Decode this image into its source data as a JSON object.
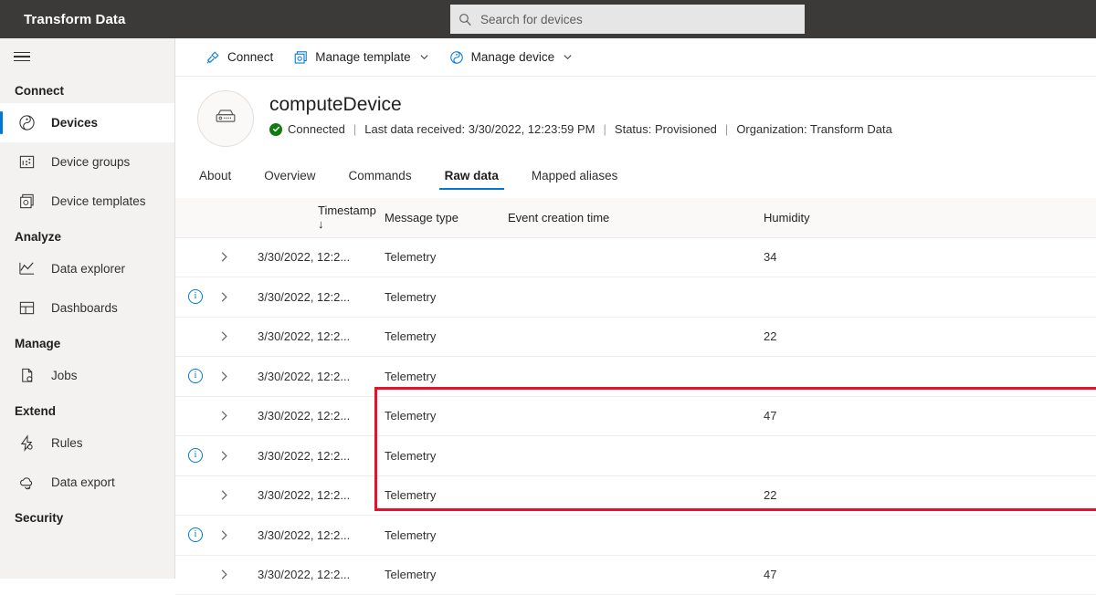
{
  "topbar": {
    "brand": "Transform Data",
    "search": {
      "placeholder": "Search for devices",
      "value": "",
      "icon": "search-icon"
    }
  },
  "sidebar": {
    "menu_icon": "hamburger-icon",
    "groups": [
      {
        "title": "Connect",
        "items": [
          {
            "label": "Devices",
            "icon": "devices-icon",
            "active": true
          },
          {
            "label": "Device groups",
            "icon": "device-groups-icon",
            "active": false
          },
          {
            "label": "Device templates",
            "icon": "device-templates-icon",
            "active": false
          }
        ]
      },
      {
        "title": "Analyze",
        "items": [
          {
            "label": "Data explorer",
            "icon": "data-explorer-icon",
            "active": false
          },
          {
            "label": "Dashboards",
            "icon": "dashboards-icon",
            "active": false
          }
        ]
      },
      {
        "title": "Manage",
        "items": [
          {
            "label": "Jobs",
            "icon": "jobs-icon",
            "active": false
          }
        ]
      },
      {
        "title": "Extend",
        "items": [
          {
            "label": "Rules",
            "icon": "rules-icon",
            "active": false
          },
          {
            "label": "Data export",
            "icon": "data-export-icon",
            "active": false
          }
        ]
      },
      {
        "title": "Security",
        "items": []
      }
    ]
  },
  "commandbar": {
    "items": [
      {
        "label": "Connect",
        "icon": "plug-icon",
        "has_chevron": false
      },
      {
        "label": "Manage template",
        "icon": "template-icon",
        "has_chevron": true
      },
      {
        "label": "Manage device",
        "icon": "device-icon",
        "has_chevron": true
      }
    ]
  },
  "device": {
    "avatar_icon": "server-device-icon",
    "name": "computeDevice",
    "connection_status": "Connected",
    "connection_icon": "check-circle-icon",
    "last_data_label": "Last data received: 3/30/2022, 12:23:59 PM",
    "status_label": "Status: Provisioned",
    "organization_label": "Organization: Transform Data",
    "separator": "|"
  },
  "tabs": [
    {
      "label": "About",
      "selected": false
    },
    {
      "label": "Overview",
      "selected": false
    },
    {
      "label": "Commands",
      "selected": false
    },
    {
      "label": "Raw data",
      "selected": true
    },
    {
      "label": "Mapped aliases",
      "selected": false
    }
  ],
  "table": {
    "columns": [
      {
        "key": "timestamp",
        "label": "Timestamp",
        "sort_indicator": "↓"
      },
      {
        "key": "message_type",
        "label": "Message type",
        "sort_indicator": ""
      },
      {
        "key": "event_creation_time",
        "label": "Event creation time",
        "sort_indicator": ""
      },
      {
        "key": "humidity",
        "label": "Humidity",
        "sort_indicator": ""
      }
    ],
    "expand_icon": "chevron-right-icon",
    "info_icon": "info-circle-icon",
    "rows": [
      {
        "has_info": false,
        "timestamp": "3/30/2022, 12:2...",
        "message_type": "Telemetry",
        "event_creation_time": "",
        "humidity": "34"
      },
      {
        "has_info": true,
        "timestamp": "3/30/2022, 12:2...",
        "message_type": "Telemetry",
        "event_creation_time": "",
        "humidity": ""
      },
      {
        "has_info": false,
        "timestamp": "3/30/2022, 12:2...",
        "message_type": "Telemetry",
        "event_creation_time": "",
        "humidity": "22"
      },
      {
        "has_info": true,
        "timestamp": "3/30/2022, 12:2...",
        "message_type": "Telemetry",
        "event_creation_time": "",
        "humidity": ""
      },
      {
        "has_info": false,
        "timestamp": "3/30/2022, 12:2...",
        "message_type": "Telemetry",
        "event_creation_time": "",
        "humidity": "47"
      },
      {
        "has_info": true,
        "timestamp": "3/30/2022, 12:2...",
        "message_type": "Telemetry",
        "event_creation_time": "",
        "humidity": ""
      },
      {
        "has_info": false,
        "timestamp": "3/30/2022, 12:2...",
        "message_type": "Telemetry",
        "event_creation_time": "",
        "humidity": "22"
      },
      {
        "has_info": true,
        "timestamp": "3/30/2022, 12:2...",
        "message_type": "Telemetry",
        "event_creation_time": "",
        "humidity": ""
      },
      {
        "has_info": false,
        "timestamp": "3/30/2022, 12:2...",
        "message_type": "Telemetry",
        "event_creation_time": "",
        "humidity": "47"
      }
    ]
  },
  "annotation": {
    "highlight_color": "#e8112d",
    "shape": "rectangle"
  },
  "colors": {
    "topbar_bg": "#3b3a39",
    "sidebar_bg": "#f3f2f1",
    "accent": "#0078d4",
    "connected": "#107c10",
    "header_row_bg": "#faf9f8"
  }
}
